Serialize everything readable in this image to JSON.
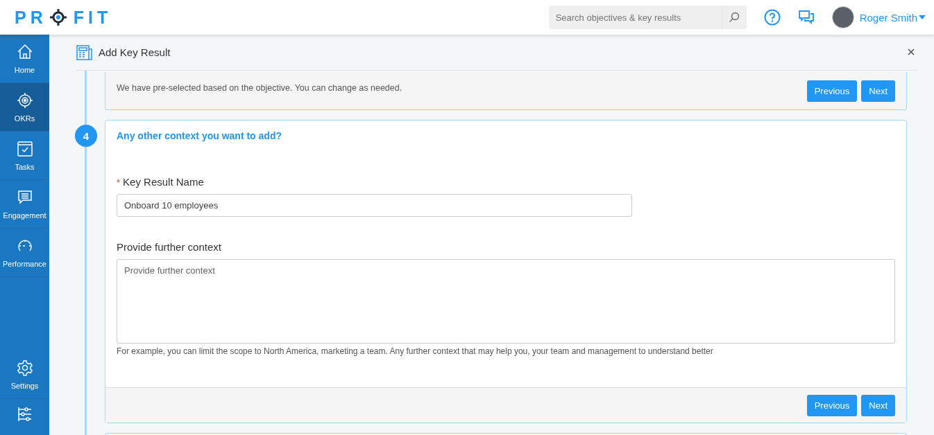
{
  "logo": {
    "before": "PR",
    "after": "FIT"
  },
  "search": {
    "placeholder": "Search objectives & key results"
  },
  "user": {
    "name": "Roger Smith"
  },
  "sidebar": {
    "items": [
      {
        "label": "Home",
        "selected": false
      },
      {
        "label": "OKRs",
        "selected": true
      },
      {
        "label": "Tasks",
        "selected": false
      },
      {
        "label": "Engagement",
        "selected": false
      },
      {
        "label": "Performance",
        "selected": false
      }
    ],
    "bottom_items": [
      {
        "label": "Settings",
        "selected": false
      },
      {
        "selected": false
      }
    ]
  },
  "dialog": {
    "title": "Add Key Result"
  },
  "previous_step": {
    "text": "We have pre-selected based on the objective. You can change as needed.",
    "buttons": [
      "Previous",
      "Next"
    ]
  },
  "step": {
    "number": "4",
    "title": "Any other context you want to add?",
    "fields": [
      {
        "kind": "input",
        "label": "Key Result Name",
        "required_mark": "*",
        "value": "Onboard 10 employees"
      },
      {
        "kind": "textarea",
        "label": "Provide further context",
        "placeholder": "Provide further context",
        "hint": "For example, you can limit the scope to North America, marketing a team. Any further context that may help you, your team and management to understand better"
      }
    ],
    "buttons": [
      "Previous",
      "Next"
    ]
  }
}
